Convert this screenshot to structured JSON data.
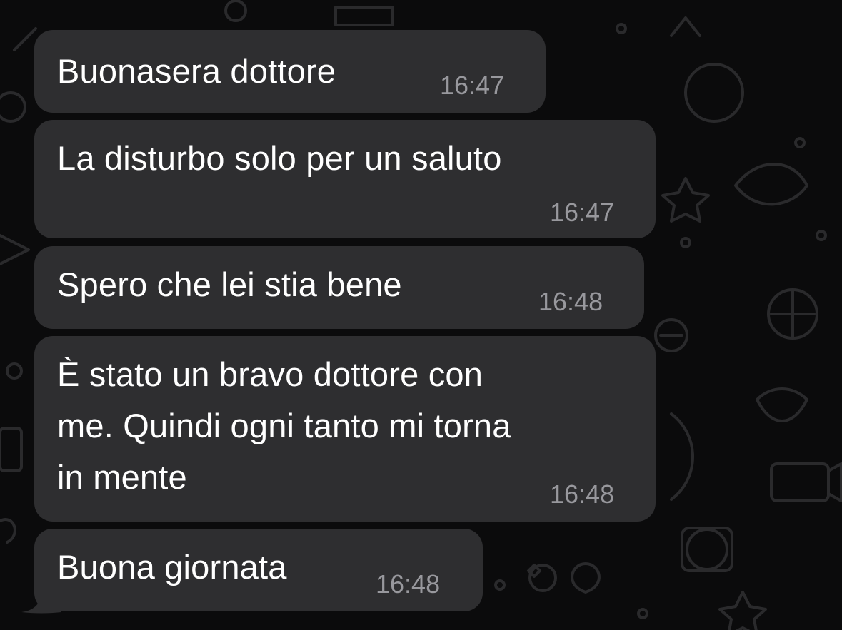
{
  "chat": {
    "colors": {
      "background": "#0b0b0c",
      "bubble": "#2e2e30",
      "text": "#ffffff",
      "timestamp": "#98989d",
      "wallpaper_doodle": "#2a2a2c"
    },
    "messages": [
      {
        "lines": [
          "Buonasera dottore"
        ],
        "time": "16:47"
      },
      {
        "lines": [
          "La disturbo solo per un saluto"
        ],
        "time": "16:47"
      },
      {
        "lines": [
          "Spero che lei stia bene"
        ],
        "time": "16:48"
      },
      {
        "lines": [
          "È stato un bravo dottore con",
          "me. Quindi ogni tanto mi torna",
          "in mente"
        ],
        "time": "16:48"
      },
      {
        "lines": [
          "Buona giornata"
        ],
        "time": "16:48"
      }
    ]
  }
}
